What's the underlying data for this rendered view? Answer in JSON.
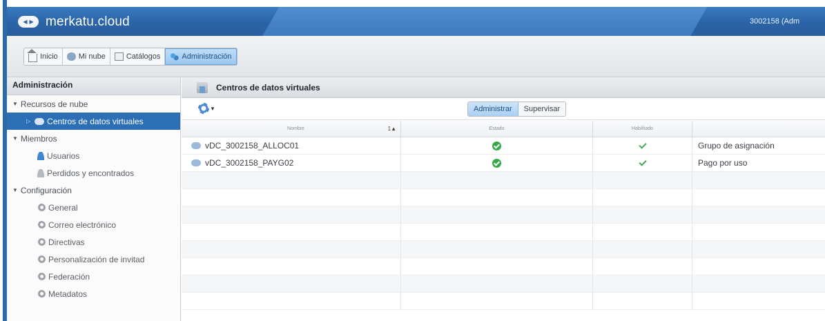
{
  "header": {
    "brand": "merkatu.cloud",
    "user": "3002158   (Adm",
    "nav_arrows": [
      "◀",
      "▶"
    ]
  },
  "tabs": [
    {
      "label": "Inicio",
      "icon": "home-icon"
    },
    {
      "label": "Mi nube",
      "icon": "cloud-icon"
    },
    {
      "label": "Catálogos",
      "icon": "catalog-icon"
    },
    {
      "label": "Administración",
      "icon": "admin-icon",
      "active": true
    }
  ],
  "sidebar": {
    "title": "Administración",
    "groups": [
      {
        "label": "Recursos de nube",
        "items": [
          {
            "label": "Centros de datos virtuales",
            "selected": true
          }
        ]
      },
      {
        "label": "Miembros",
        "items": [
          {
            "label": "Usuarios"
          },
          {
            "label": "Perdidos y encontrados"
          }
        ]
      },
      {
        "label": "Configuración",
        "items": [
          {
            "label": "General"
          },
          {
            "label": "Correo electrónico"
          },
          {
            "label": "Directivas"
          },
          {
            "label": "Personalización de invitad"
          },
          {
            "label": "Federación"
          },
          {
            "label": "Metadatos"
          }
        ]
      }
    ]
  },
  "main": {
    "title": "Centros de datos virtuales",
    "toggle": {
      "left": "Administrar",
      "right": "Supervisar",
      "selected": "Administrar"
    },
    "table": {
      "columns": [
        "Nombre",
        "Estado",
        "Habilitado",
        ""
      ],
      "sort_indicator": "1▲",
      "rows": [
        {
          "name": "vDC_3002158_ALLOC01",
          "state": "ok",
          "enabled": true,
          "type": "Grupo de asignación"
        },
        {
          "name": "vDC_3002158_PAYG02",
          "state": "ok",
          "enabled": true,
          "type": "Pago por uso"
        }
      ]
    }
  },
  "colors": {
    "header_blue": "#2a63a6",
    "selection_blue": "#2d6fb5",
    "ok_green": "#37a84a"
  }
}
